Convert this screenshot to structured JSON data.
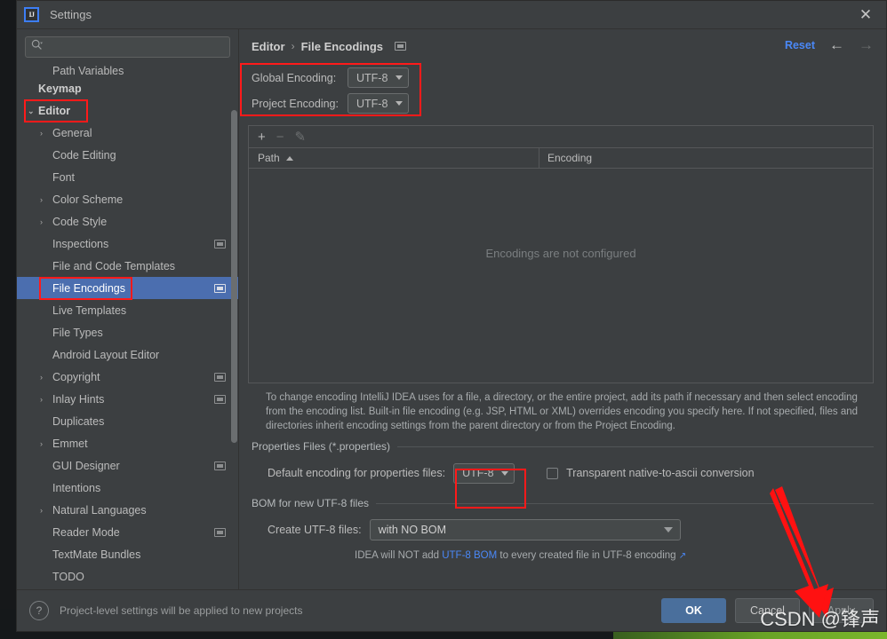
{
  "window": {
    "title": "Settings",
    "logo_text": "IJ",
    "close_icon": "close-icon"
  },
  "search": {
    "placeholder": "",
    "value": "",
    "icon": "search-icon"
  },
  "sidebar": {
    "items": [
      {
        "label": "Path Variables",
        "indent": 1,
        "arrow": "",
        "bold": false,
        "selected": false,
        "badge": false,
        "clipped": true
      },
      {
        "label": "Keymap",
        "indent": 0,
        "arrow": "",
        "bold": true,
        "selected": false,
        "badge": false
      },
      {
        "label": "Editor",
        "indent": 0,
        "arrow": "⌄",
        "bold": true,
        "selected": false,
        "badge": false
      },
      {
        "label": "General",
        "indent": 1,
        "arrow": "›",
        "bold": false,
        "selected": false,
        "badge": false
      },
      {
        "label": "Code Editing",
        "indent": 1,
        "arrow": "",
        "bold": false,
        "selected": false,
        "badge": false
      },
      {
        "label": "Font",
        "indent": 1,
        "arrow": "",
        "bold": false,
        "selected": false,
        "badge": false
      },
      {
        "label": "Color Scheme",
        "indent": 1,
        "arrow": "›",
        "bold": false,
        "selected": false,
        "badge": false
      },
      {
        "label": "Code Style",
        "indent": 1,
        "arrow": "›",
        "bold": false,
        "selected": false,
        "badge": false
      },
      {
        "label": "Inspections",
        "indent": 1,
        "arrow": "",
        "bold": false,
        "selected": false,
        "badge": true
      },
      {
        "label": "File and Code Templates",
        "indent": 1,
        "arrow": "",
        "bold": false,
        "selected": false,
        "badge": false
      },
      {
        "label": "File Encodings",
        "indent": 1,
        "arrow": "",
        "bold": false,
        "selected": true,
        "badge": true
      },
      {
        "label": "Live Templates",
        "indent": 1,
        "arrow": "",
        "bold": false,
        "selected": false,
        "badge": false
      },
      {
        "label": "File Types",
        "indent": 1,
        "arrow": "",
        "bold": false,
        "selected": false,
        "badge": false
      },
      {
        "label": "Android Layout Editor",
        "indent": 1,
        "arrow": "",
        "bold": false,
        "selected": false,
        "badge": false
      },
      {
        "label": "Copyright",
        "indent": 1,
        "arrow": "›",
        "bold": false,
        "selected": false,
        "badge": true
      },
      {
        "label": "Inlay Hints",
        "indent": 1,
        "arrow": "›",
        "bold": false,
        "selected": false,
        "badge": true
      },
      {
        "label": "Duplicates",
        "indent": 1,
        "arrow": "",
        "bold": false,
        "selected": false,
        "badge": false
      },
      {
        "label": "Emmet",
        "indent": 1,
        "arrow": "›",
        "bold": false,
        "selected": false,
        "badge": false
      },
      {
        "label": "GUI Designer",
        "indent": 1,
        "arrow": "",
        "bold": false,
        "selected": false,
        "badge": true
      },
      {
        "label": "Intentions",
        "indent": 1,
        "arrow": "",
        "bold": false,
        "selected": false,
        "badge": false
      },
      {
        "label": "Natural Languages",
        "indent": 1,
        "arrow": "›",
        "bold": false,
        "selected": false,
        "badge": false
      },
      {
        "label": "Reader Mode",
        "indent": 1,
        "arrow": "",
        "bold": false,
        "selected": false,
        "badge": true
      },
      {
        "label": "TextMate Bundles",
        "indent": 1,
        "arrow": "",
        "bold": false,
        "selected": false,
        "badge": false
      },
      {
        "label": "TODO",
        "indent": 1,
        "arrow": "",
        "bold": false,
        "selected": false,
        "badge": false
      }
    ]
  },
  "main": {
    "breadcrumb": {
      "parent": "Editor",
      "separator": "›",
      "current": "File Encodings"
    },
    "reset_label": "Reset",
    "back_arrow": "←",
    "forward_arrow": "→",
    "encodings": {
      "global_label": "Global Encoding:",
      "global_value": "UTF-8",
      "project_label": "Project Encoding:",
      "project_value": "UTF-8"
    },
    "toolbar": {
      "add": "+",
      "remove": "−",
      "edit": "✎"
    },
    "table": {
      "col_path": "Path",
      "col_encoding": "Encoding",
      "empty_text": "Encodings are not configured"
    },
    "description": "To change encoding IntelliJ IDEA uses for a file, a directory, or the entire project, add its path if necessary and then select encoding from the encoding list. Built-in file encoding (e.g. JSP, HTML or XML) overrides encoding you specify here. If not specified, files and directories inherit encoding settings from the parent directory or from the Project Encoding.",
    "properties_group": {
      "title": "Properties Files (*.properties)",
      "default_encoding_label": "Default encoding for properties files:",
      "default_encoding_value": "UTF-8",
      "native_checkbox_label": "Transparent native-to-ascii conversion",
      "native_checkbox_checked": false
    },
    "bom_group": {
      "title": "BOM for new UTF-8 files",
      "create_label": "Create UTF-8 files:",
      "create_value": "with NO BOM",
      "note_prefix": "IDEA will NOT add ",
      "note_link": "UTF-8 BOM",
      "note_suffix": " to every created file in UTF-8 encoding",
      "note_ext_icon": "↗"
    }
  },
  "footer": {
    "help_icon": "?",
    "note": "Project-level settings will be applied to new projects",
    "ok_label": "OK",
    "cancel_label": "Cancel",
    "apply_label": "Apply"
  },
  "watermark": {
    "text": "CSDN @锋声"
  },
  "colors": {
    "dialog_bg": "#3c3f41",
    "selection_blue": "#4b6eaf",
    "link_blue": "#4a88f7",
    "primary_button": "#4a6f9c",
    "annotation_red": "#ff1a1a",
    "text": "#bbbbbb"
  }
}
